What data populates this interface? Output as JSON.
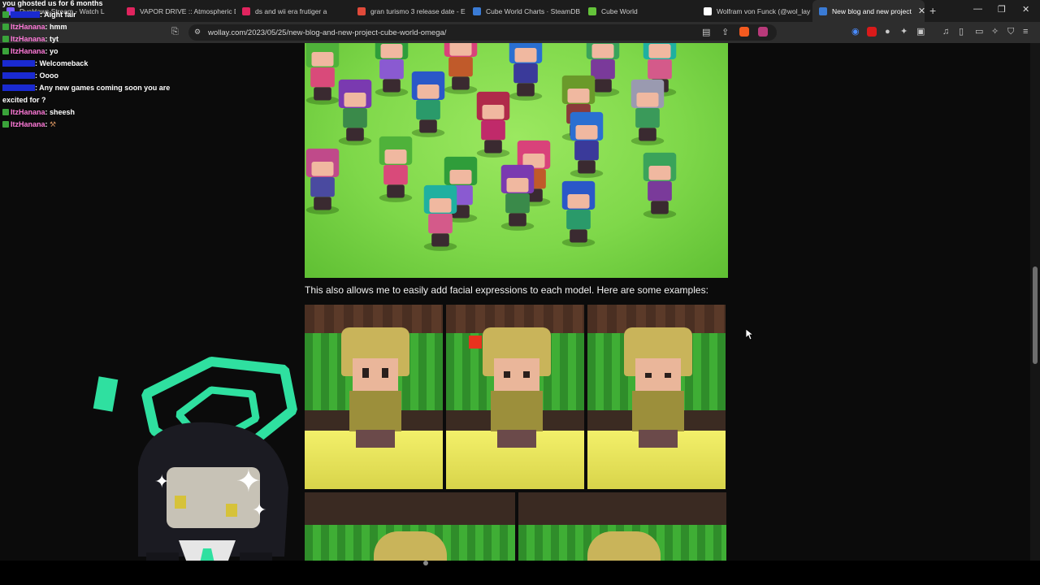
{
  "tabs": [
    {
      "label": "RyeHaws Stream - Watch L",
      "fav": "#7a5cff",
      "active": false
    },
    {
      "label": "VAPOR DRIVE :: Atmospheric D",
      "fav": "#e0245e",
      "active": false
    },
    {
      "label": "ds and wii era frutiger a",
      "fav": "#e0245e",
      "active": false
    },
    {
      "label": "gran turismo 3 release date - E",
      "fav": "#e04a3a",
      "active": false
    },
    {
      "label": "Cube World Charts · SteamDB",
      "fav": "#3a7bd5",
      "active": false
    },
    {
      "label": "Cube World",
      "fav": "#64c33a",
      "active": false
    },
    {
      "label": "Wolfram von Funck (@wol_lay",
      "fav": "#ffffff",
      "active": false
    },
    {
      "label": "New blog and new project",
      "fav": "#3a7bd5",
      "active": true
    }
  ],
  "address": {
    "url": "wollay.com/2023/05/25/new-blog-and-new-project-cube-world-omega/"
  },
  "article": {
    "caption": "This also allows me to easily add facial expressions to each model. Here are some examples:"
  },
  "chat": [
    {
      "user": "",
      "text": "you ghosted us for 6 months",
      "user_color": "u1"
    },
    {
      "user": "",
      "text": ": Aight fair",
      "user_color": "u2"
    },
    {
      "user": "ItzHanana",
      "text": ": hmm",
      "user_color": "u1"
    },
    {
      "user": "ItzHanana",
      "text": ": tyt",
      "user_color": "u1"
    },
    {
      "user": "ItzHanana",
      "text": ": yo",
      "user_color": "u1"
    },
    {
      "user": "",
      "text": ": Welcomeback",
      "user_color": "u2"
    },
    {
      "user": "",
      "text": ": Oooo",
      "user_color": "u2"
    },
    {
      "user": "",
      "text": ": Any new games coming soon you are excited for ?",
      "user_color": "u2"
    },
    {
      "user": "ItzHanana",
      "text": ": sheesh",
      "user_color": "u1"
    },
    {
      "user": "ItzHanana",
      "text": ": ",
      "user_color": "u1"
    }
  ],
  "icons": [
    "bookmark-icon",
    "site-info-icon",
    "reader-icon",
    "share-icon",
    "brave-shield-icon",
    "extensions-icon",
    "sidebar-icon",
    "wallet-icon",
    "leo-icon",
    "vpn-icon",
    "menu-icon"
  ]
}
